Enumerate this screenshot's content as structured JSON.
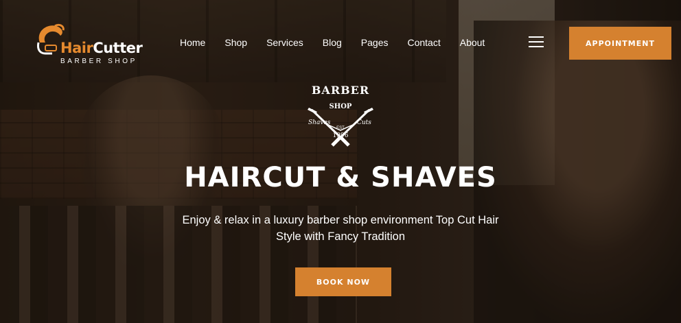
{
  "brand": {
    "title_part1": "Hair",
    "title_part2": "Cutter",
    "subtitle": "BARBER SHOP"
  },
  "nav": {
    "items": [
      "Home",
      "Shop",
      "Services",
      "Blog",
      "Pages",
      "Contact",
      "About"
    ]
  },
  "header": {
    "appointment_label": "Appointment",
    "menu_icon": "hamburger-menu-icon"
  },
  "badge": {
    "top": "BARBER",
    "shop": "SHOP",
    "left": "Shaves",
    "right": "Cuts",
    "est": "EST",
    "year": "1996",
    "icon": "crossed-razors-icon"
  },
  "hero": {
    "headline": "HAIRCUT & SHAVES",
    "subtitle": "Enjoy & relax in a luxury barber shop environment Top Cut Hair Style with Fancy Tradition",
    "cta_label": "Book Now"
  },
  "colors": {
    "accent": "#d5812f",
    "text": "#ffffff"
  }
}
